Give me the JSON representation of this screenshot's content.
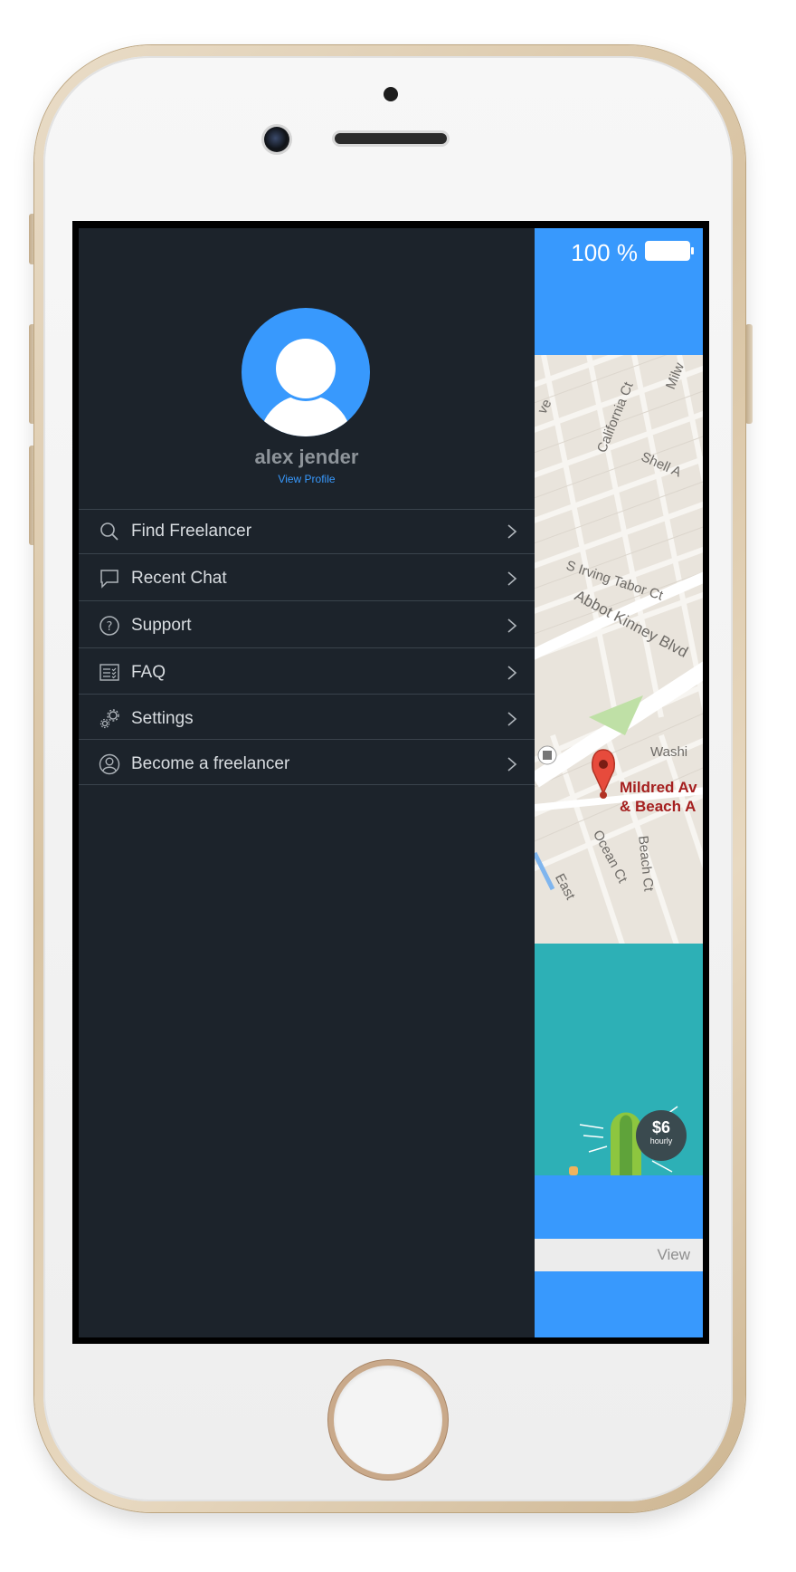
{
  "colors": {
    "accent": "#3899fd",
    "drawer_bg": "#1c232b",
    "divider": "#3a434c",
    "teal": "#2db0b6",
    "map_bg": "#e9e4dc",
    "pin": "#e74b3c"
  },
  "status_bar": {
    "battery_text": "100 %"
  },
  "profile": {
    "name": "alex jender",
    "link": "View Profile"
  },
  "menu": {
    "items": [
      {
        "label": "Find Freelancer",
        "icon": "search-icon"
      },
      {
        "label": "Recent Chat",
        "icon": "chat-bubble-icon"
      },
      {
        "label": "Support",
        "icon": "help-circle-icon"
      },
      {
        "label": "FAQ",
        "icon": "faq-list-icon"
      },
      {
        "label": "Settings",
        "icon": "gears-icon"
      },
      {
        "label": "Become a freelancer",
        "icon": "user-outline-icon"
      }
    ]
  },
  "map": {
    "streets": [
      "California Ct",
      "Milw",
      "Shell A",
      "ve",
      "S Irving Tabor Ct",
      "Abbot Kinney Blvd",
      "Washi",
      "Ocean Ct",
      "Beach Ct",
      "East"
    ],
    "place": [
      "Mildred Av",
      "& Beach A"
    ]
  },
  "card": {
    "price": "$6",
    "price_unit": "hourly"
  },
  "action": {
    "view_label": "View"
  }
}
